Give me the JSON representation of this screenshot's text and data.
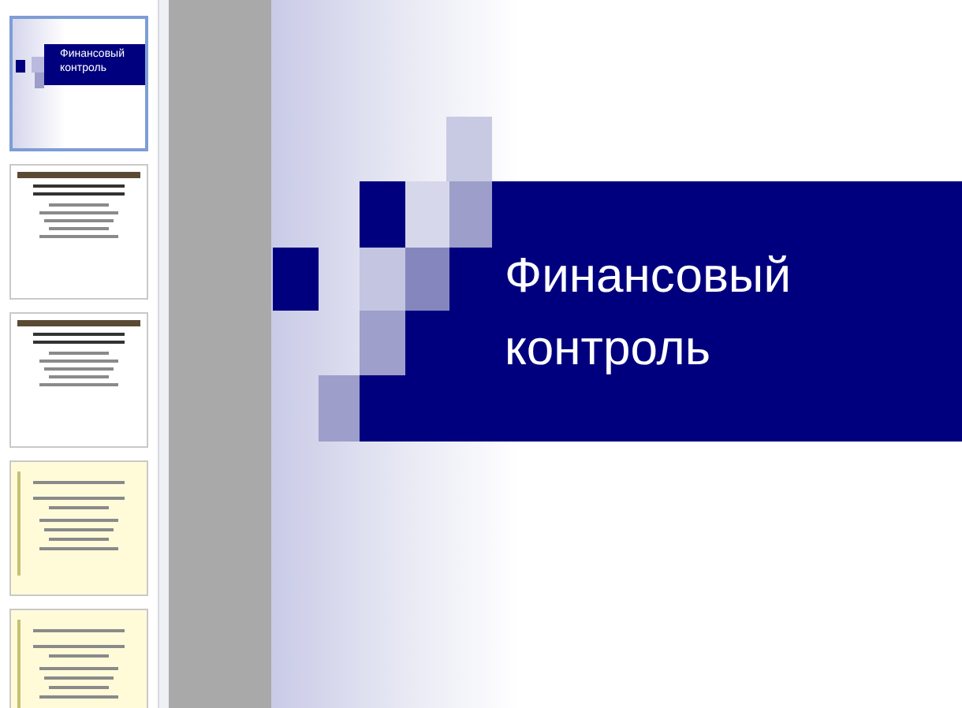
{
  "slides_panel": {
    "slides": [
      {
        "kind": "title",
        "selected": true,
        "title": "Финансовый контроль"
      },
      {
        "kind": "plain",
        "selected": false
      },
      {
        "kind": "plain",
        "selected": false
      },
      {
        "kind": "note",
        "selected": false
      },
      {
        "kind": "note",
        "selected": false
      }
    ]
  },
  "slide": {
    "title_lines": [
      "Финансовый",
      "контроль"
    ]
  }
}
